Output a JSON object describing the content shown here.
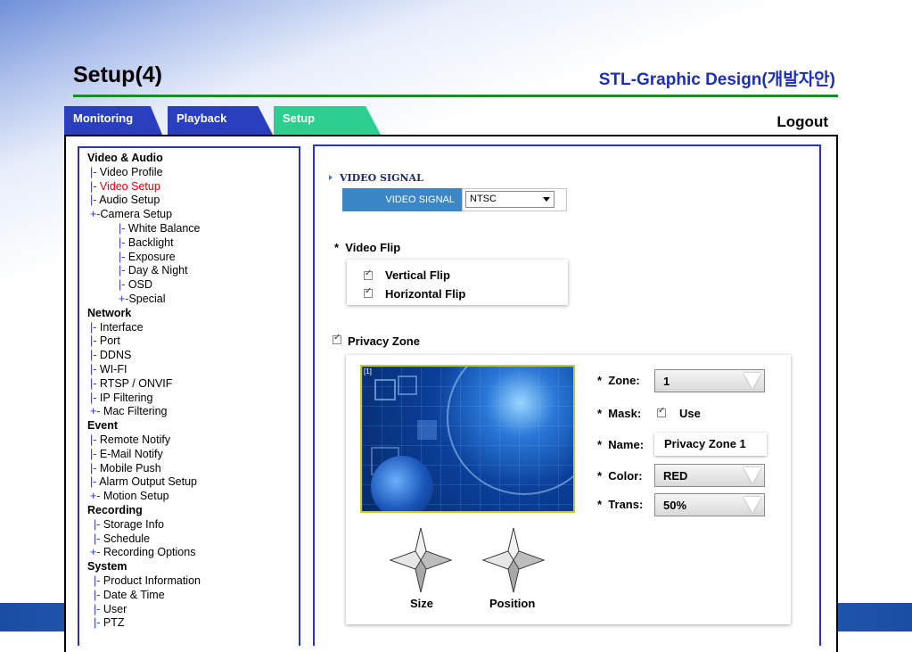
{
  "header": {
    "page_title": "Setup(4)",
    "design_title": "STL-Graphic Design(개발자안)",
    "logout_label": "Logout"
  },
  "tabs": [
    {
      "label": "Monitoring"
    },
    {
      "label": "Playback"
    },
    {
      "label": "Setup"
    }
  ],
  "menu": [
    {
      "section": "Video & Audio"
    },
    {
      "prefix": "|- ",
      "label": "Video Profile",
      "level": 1
    },
    {
      "prefix": "|- ",
      "label": "Video Setup",
      "level": 1,
      "active": true
    },
    {
      "prefix": "|- ",
      "label": "Audio Setup",
      "level": 1
    },
    {
      "prefix": "+-",
      "label": "Camera Setup",
      "level": 1
    },
    {
      "prefix": "|- ",
      "label": "White Balance",
      "level": 2
    },
    {
      "prefix": "|- ",
      "label": "Backlight",
      "level": 2
    },
    {
      "prefix": "|- ",
      "label": "Exposure",
      "level": 2
    },
    {
      "prefix": "|- ",
      "label": "Day & Night",
      "level": 2
    },
    {
      "prefix": "|- ",
      "label": "OSD",
      "level": 2
    },
    {
      "prefix": "+-",
      "label": "Special",
      "level": 2
    },
    {
      "section": "Network"
    },
    {
      "prefix": "|- ",
      "label": "Interface",
      "level": 1
    },
    {
      "prefix": "|- ",
      "label": "Port",
      "level": 1
    },
    {
      "prefix": "|- ",
      "label": "DDNS",
      "level": 1
    },
    {
      "prefix": "|- ",
      "label": "WI-FI",
      "level": 1
    },
    {
      "prefix": "|- ",
      "label": "RTSP / ONVIF",
      "level": 1
    },
    {
      "prefix": "|- ",
      "label": "IP Filtering",
      "level": 1
    },
    {
      "prefix": "+- ",
      "label": "Mac Filtering",
      "level": 1
    },
    {
      "section": "Event"
    },
    {
      "prefix": "|- ",
      "label": "Remote Notify",
      "level": 1
    },
    {
      "prefix": "|- ",
      "label": "E-Mail Notify",
      "level": 1
    },
    {
      "prefix": "|- ",
      "label": "Mobile Push",
      "level": 1
    },
    {
      "prefix": "|- ",
      "label": "Alarm Output Setup",
      "level": 1
    },
    {
      "prefix": "+- ",
      "label": "Motion Setup",
      "level": 1
    },
    {
      "section": "Recording"
    },
    {
      "prefix": "|- ",
      "label": "Storage Info",
      "level": 3
    },
    {
      "prefix": "|- ",
      "label": "Schedule",
      "level": 3
    },
    {
      "prefix": "+- ",
      "label": "Recording Options",
      "level": 1
    },
    {
      "section": "System"
    },
    {
      "prefix": "|- ",
      "label": "Product Information",
      "level": 3
    },
    {
      "prefix": "|- ",
      "label": "Date & Time",
      "level": 3
    },
    {
      "prefix": "|- ",
      "label": "User",
      "level": 3
    },
    {
      "prefix": "|- ",
      "label": "PTZ",
      "level": 3
    }
  ],
  "video_signal": {
    "section_title": "VIDEO SIGNAL",
    "field_label": "VIDEO SIGNAL",
    "value": "NTSC"
  },
  "video_flip": {
    "title": "Video Flip",
    "vertical_label": "Vertical Flip",
    "horizontal_label": "Horizontal Flip",
    "vertical_checked": true,
    "horizontal_checked": true
  },
  "privacy_zone": {
    "title": "Privacy Zone",
    "enabled": true,
    "preview_tag": "[1]",
    "zone_label": "Zone:",
    "zone_value": "1",
    "mask_label": "Mask:",
    "mask_use_label": "Use",
    "mask_checked": true,
    "name_label": "Name:",
    "name_value": "Privacy Zone 1",
    "color_label": "Color:",
    "color_value": "RED",
    "trans_label": "Trans:",
    "trans_value": "50%",
    "size_label": "Size",
    "position_label": "Position",
    "bullet": "*"
  },
  "colors": {
    "tab_blue": "#2a3fbf",
    "tab_active": "#2ccf8f",
    "rule_green": "#1a8a2a",
    "panel_border": "#2a35b8",
    "active_menu": "#e00000",
    "signal_label_bg": "#3d86c6"
  }
}
